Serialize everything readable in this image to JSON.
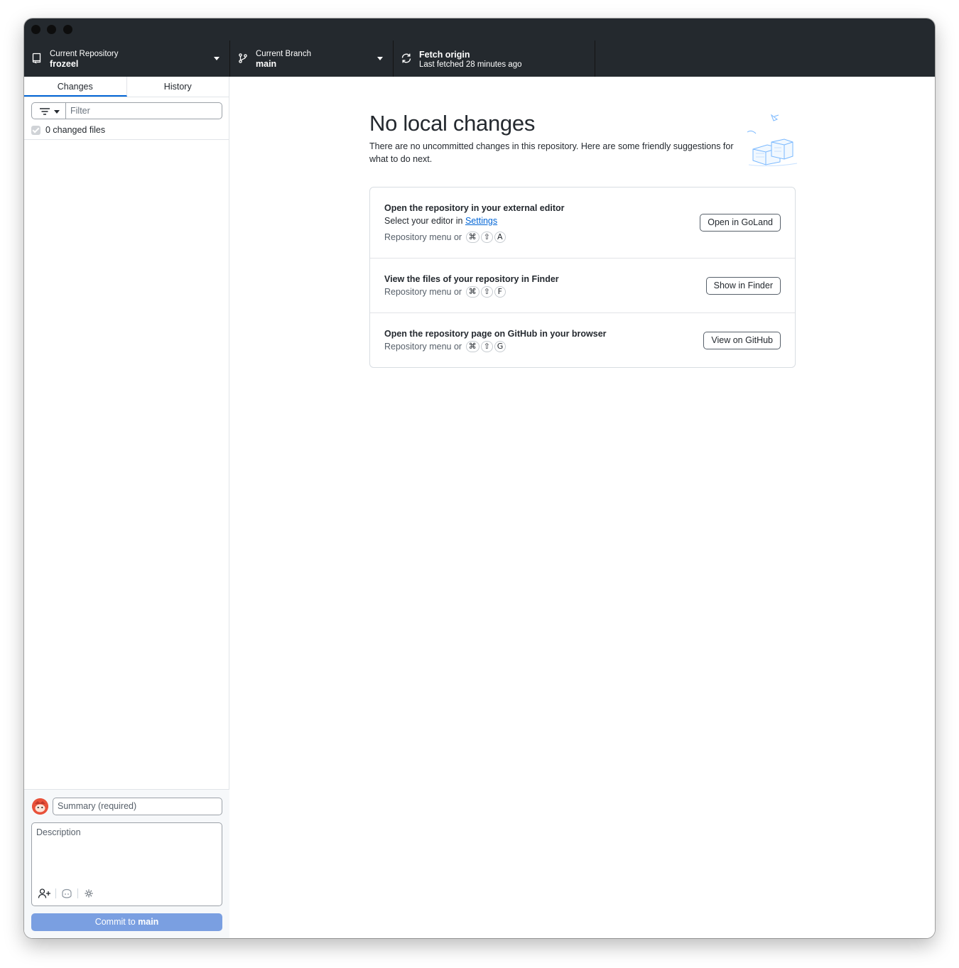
{
  "toolbar": {
    "repository": {
      "description": "Current Repository",
      "title": "frozeel"
    },
    "branch": {
      "description": "Current Branch",
      "title": "main"
    },
    "fetch": {
      "title": "Fetch origin",
      "description": "Last fetched 28 minutes ago"
    }
  },
  "sidebar": {
    "tabs": [
      {
        "label": "Changes",
        "active": true
      },
      {
        "label": "History",
        "active": false
      }
    ],
    "filter_placeholder": "Filter",
    "changed_files_label": "0 changed files"
  },
  "commit": {
    "summary_placeholder": "Summary (required)",
    "description_placeholder": "Description",
    "button_prefix": "Commit to ",
    "button_branch": "main"
  },
  "main": {
    "title": "No local changes",
    "subtitle": "There are no uncommitted changes in this repository. Here are some friendly suggestions for what to do next.",
    "cards": [
      {
        "title": "Open the repository in your external editor",
        "line_prefix": "Select your editor in ",
        "line_link": "Settings",
        "hint": "Repository menu or",
        "keys": [
          "⌘",
          "⇧",
          "A"
        ],
        "button": "Open in GoLand"
      },
      {
        "title": "View the files of your repository in Finder",
        "hint": "Repository menu or",
        "keys": [
          "⌘",
          "⇧",
          "F"
        ],
        "button": "Show in Finder"
      },
      {
        "title": "Open the repository page on GitHub in your browser",
        "hint": "Repository menu or",
        "keys": [
          "⌘",
          "⇧",
          "G"
        ],
        "button": "View on GitHub"
      }
    ]
  },
  "colors": {
    "toolbar_bg": "#24292e",
    "accent": "#0366d6",
    "commit_button": "#7a9fe1"
  }
}
